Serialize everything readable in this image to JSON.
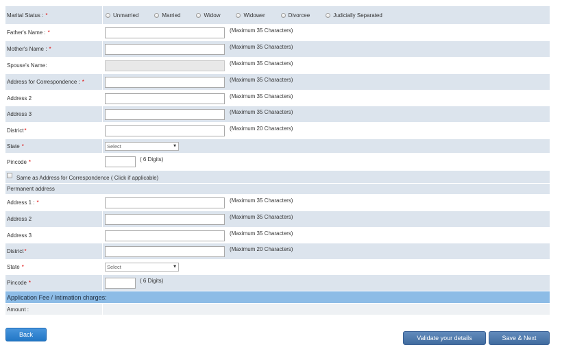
{
  "personal": {
    "marital_status": {
      "label": "Marital Status :",
      "required_mark": "*",
      "options": [
        "Unmarried",
        "Married",
        "Widow",
        "Widower",
        "Divorcee",
        "Judicially Separated"
      ]
    },
    "fathers_name": {
      "label": "Father's Name :",
      "required_mark": "*",
      "value": "",
      "hint": "(Maximum 35 Characters)"
    },
    "mothers_name": {
      "label": "Mother's Name :",
      "required_mark": "*",
      "value": "",
      "hint": "(Maximum 35 Characters)"
    },
    "spouses_name": {
      "label": "Spouse's Name:",
      "value": "",
      "hint": "(Maximum 35 Characters)",
      "disabled": true
    }
  },
  "correspondence_address": {
    "address_1": {
      "label": "Address for Correspondence :",
      "required_mark": "*",
      "value": "",
      "hint": "(Maximum 35 Characters)"
    },
    "address_2": {
      "label": "Address 2",
      "value": "",
      "hint": "(Maximum 35 Characters)"
    },
    "address_3": {
      "label": "Address 3",
      "value": "",
      "hint": "(Maximum 35 Characters)"
    },
    "district": {
      "label": "District",
      "required_mark": "*",
      "value": "",
      "hint": "(Maximum 20 Characters)"
    },
    "state": {
      "label": "State",
      "required_mark": "*",
      "selected": "Select"
    },
    "pincode": {
      "label": "Pincode",
      "required_mark": "*",
      "value": "",
      "hint": "( 6 Digits)"
    }
  },
  "same_as_correspondence": {
    "label": "Same as Address for Correspondence ( Click if applicable)",
    "checked": false
  },
  "permanent_address": {
    "title": "Permanent address",
    "address_1": {
      "label": "Address 1 :",
      "required_mark": "*",
      "value": "",
      "hint": "(Maximum 35 Characters)"
    },
    "address_2": {
      "label": "Address 2",
      "value": "",
      "hint": "(Maximum 35 Characters)"
    },
    "address_3": {
      "label": "Address 3",
      "value": "",
      "hint": "(Maximum 35 Characters)"
    },
    "district": {
      "label": "District",
      "required_mark": "*",
      "value": "",
      "hint": "(Maximum 20 Characters)"
    },
    "state": {
      "label": "State",
      "required_mark": "*",
      "selected": "Select"
    },
    "pincode": {
      "label": "Pincode",
      "required_mark": "*",
      "value": "",
      "hint": "( 6 Digits)"
    }
  },
  "fee": {
    "title": "Application Fee / Intimation charges:",
    "amount_label": "Amount :"
  },
  "buttons": {
    "back": "Back",
    "validate": "Validate your details",
    "save_next": "Save & Next"
  },
  "icons": {
    "state_dropdown": "caret-down-icon"
  },
  "colors": {
    "row_shaded": "#dce4ed",
    "section_header": "#8dbce6",
    "amount_row": "#eef1f4",
    "required_mark": "#e00000",
    "back_button": "#2581d6",
    "action_button": "#4878b1",
    "disabled_input": "#e8e8e8"
  }
}
